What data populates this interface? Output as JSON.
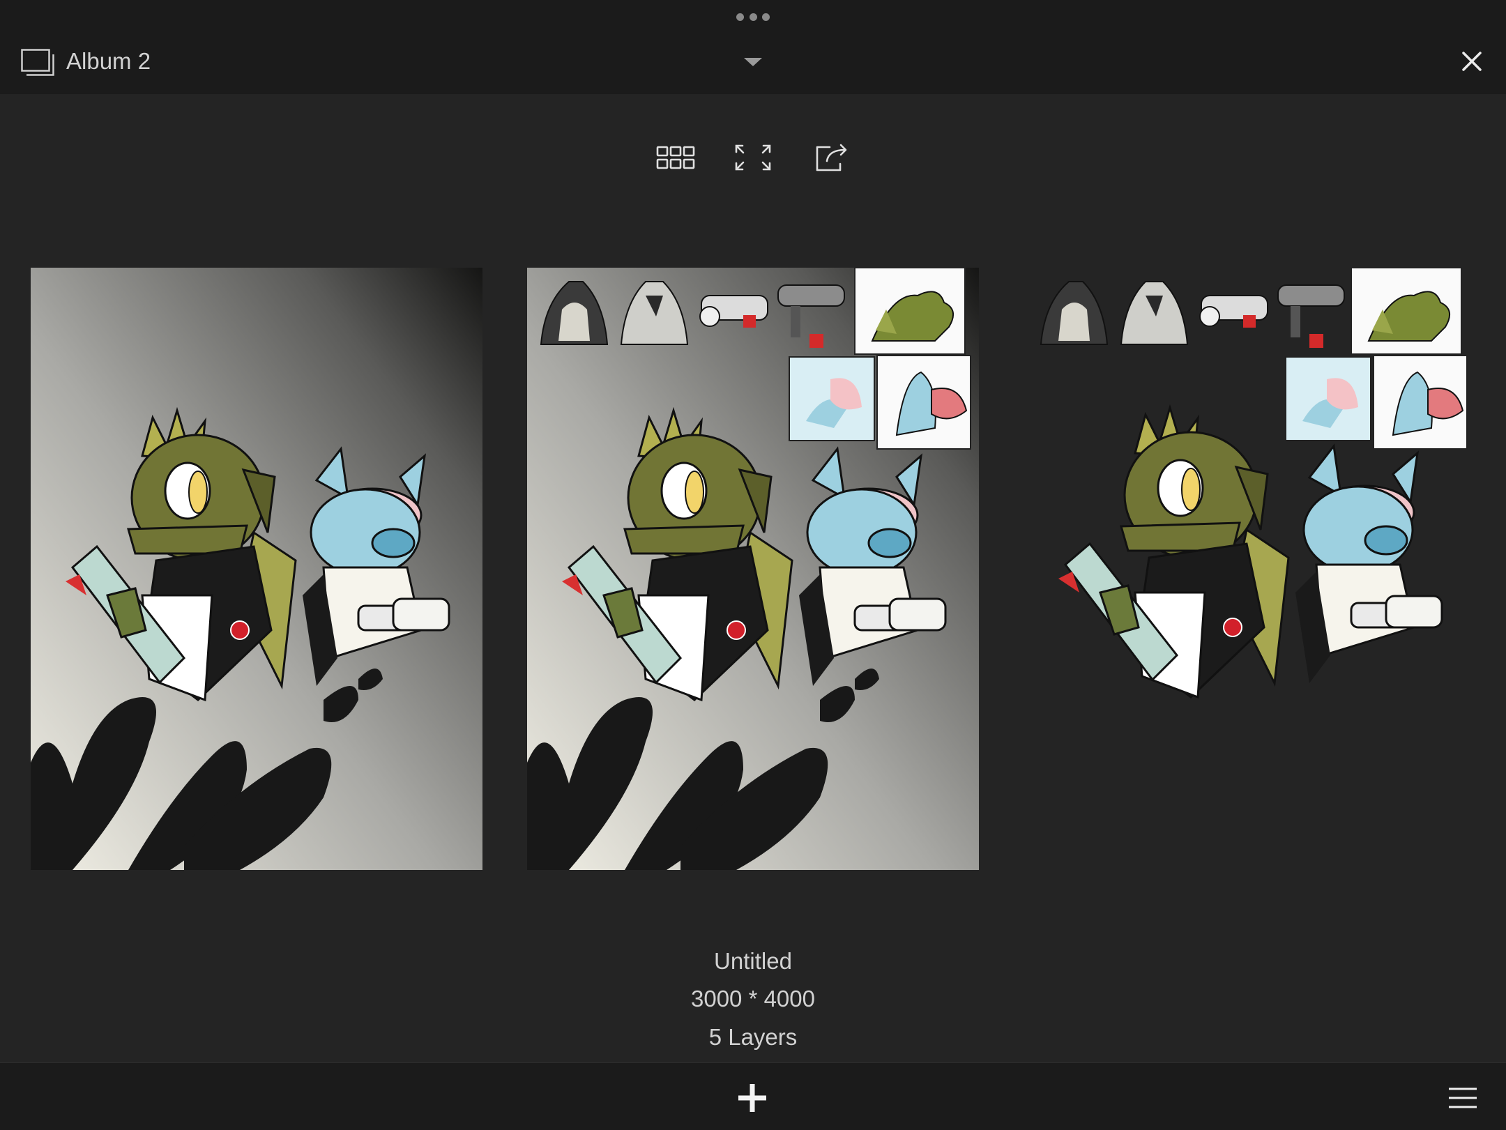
{
  "header": {
    "album_title": "Album 2",
    "album_icon": "album-stack-icon",
    "dropdown_icon": "chevron-down-icon",
    "close_icon": "close-icon",
    "handle_icon": "more-dots-icon"
  },
  "toolbar": {
    "buttons": [
      {
        "icon": "grid-view-icon"
      },
      {
        "icon": "fullscreen-expand-icon"
      },
      {
        "icon": "export-share-icon"
      }
    ]
  },
  "artworks": [
    {
      "variant": "background-only"
    },
    {
      "variant": "background-with-references"
    },
    {
      "variant": "transparent-with-references",
      "selected": true
    }
  ],
  "artwork_info": {
    "name": "Untitled",
    "dimensions": "3000 * 4000",
    "layers": "5 Layers"
  },
  "bottom_bar": {
    "add_icon": "plus-icon",
    "menu_icon": "hamburger-menu-icon"
  },
  "colors": {
    "background": "#242424",
    "bar": "#1b1b1b",
    "text": "#d2d2d2",
    "icon": "#e0e0e0"
  }
}
